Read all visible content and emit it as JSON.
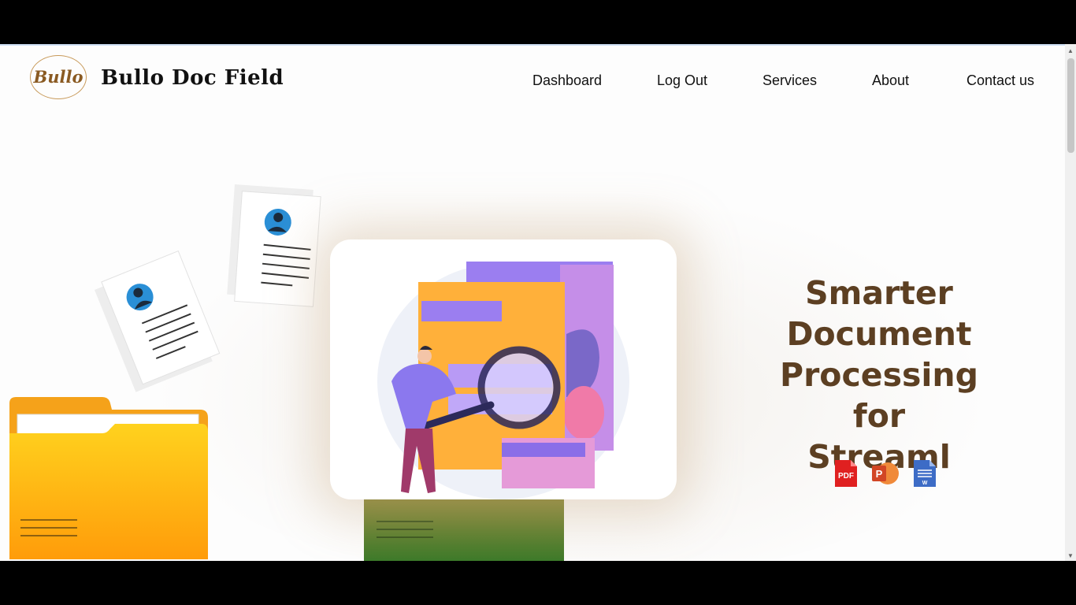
{
  "header": {
    "logo_text": "Bullo",
    "site_name": "Bullo Doc Field",
    "nav": [
      "Dashboard",
      "Log Out",
      "Services",
      "About",
      "Contact us"
    ]
  },
  "hero": {
    "headline_lines": [
      "Smarter",
      "Document",
      "Processing for",
      "Streaml"
    ],
    "file_icons": [
      {
        "name": "pdf-icon",
        "label": "PDF",
        "color": "#e02020"
      },
      {
        "name": "powerpoint-icon",
        "label": "P",
        "color": "#e3501f"
      },
      {
        "name": "word-doc-icon",
        "label": "W",
        "color": "#3d6cc6"
      }
    ]
  },
  "colors": {
    "headline": "#5c3f22",
    "logo": "#8a5a22",
    "folder": "#ffb21a"
  }
}
